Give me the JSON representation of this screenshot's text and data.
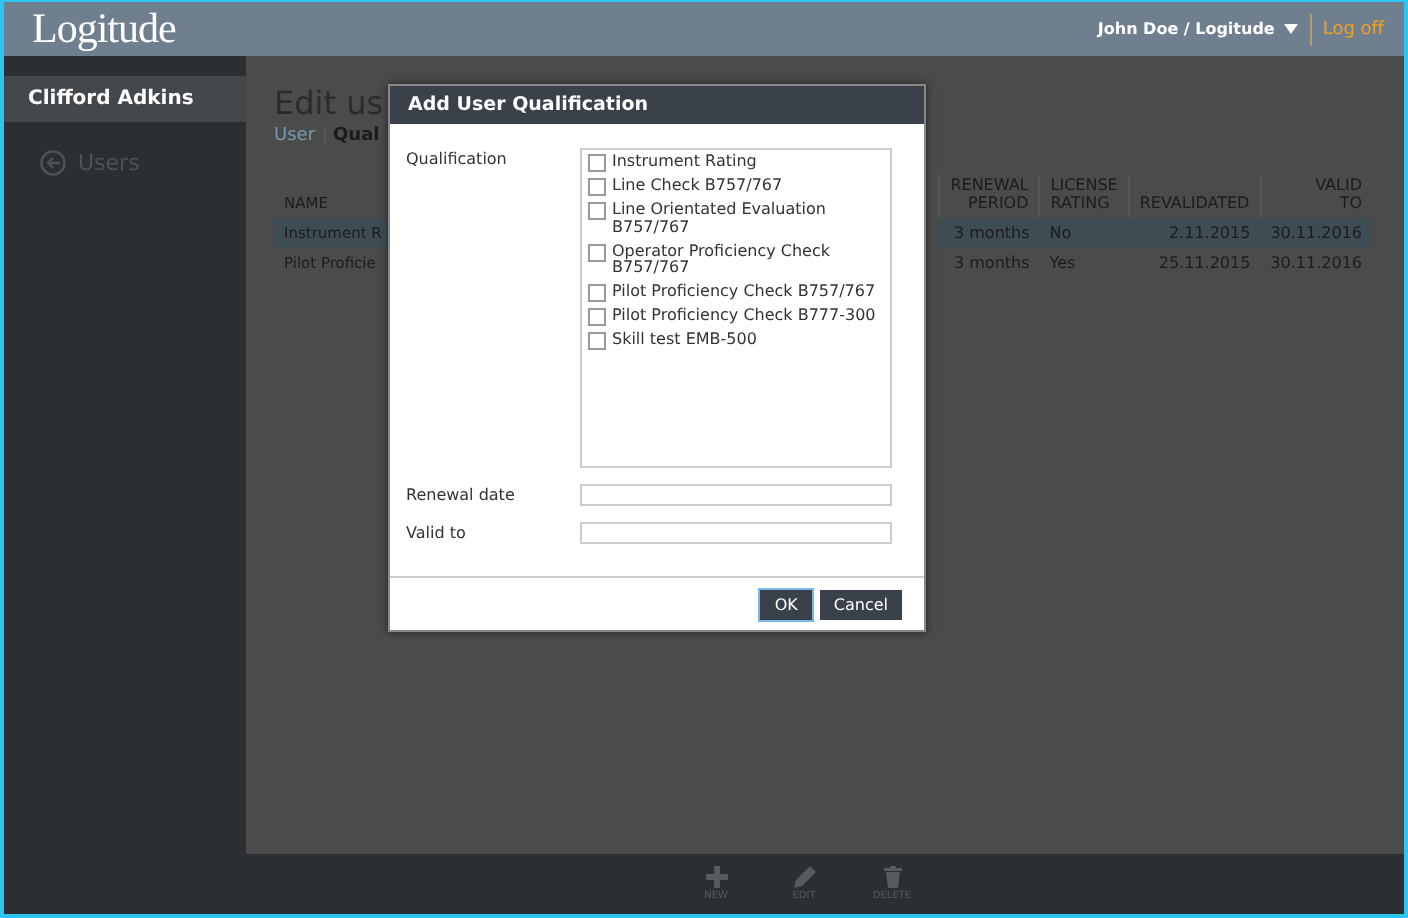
{
  "header": {
    "logo": "Logitude",
    "user": "John Doe / Logitude",
    "logoff": "Log off"
  },
  "sidebar": {
    "user_name": "Clifford Adkins",
    "items": [
      {
        "label": "Users",
        "selected": false
      }
    ]
  },
  "page": {
    "title": "Edit us",
    "breadcrumb": [
      {
        "label": "User",
        "selected": false
      },
      {
        "label": "Qual",
        "selected": true
      }
    ]
  },
  "table": {
    "columns": [
      "NAME",
      "RENEWAL PERIOD",
      "LICENSE RATING",
      "REVALIDATED",
      "VALID TO"
    ],
    "rows": [
      {
        "selected": true,
        "cells": [
          "Instrument R",
          "3 months",
          "No",
          "2.11.2015",
          "30.11.2016"
        ]
      },
      {
        "selected": false,
        "cells": [
          "Pilot Proficie",
          "3 months",
          "Yes",
          "25.11.2015",
          "30.11.2016"
        ]
      }
    ]
  },
  "dialog": {
    "title": "Add User Qualification",
    "qualification_label": "Qualification",
    "options": [
      {
        "label": "Instrument Rating",
        "checked": false
      },
      {
        "label": "Line Check B757/767",
        "checked": false
      },
      {
        "label": "Line Orientated Evaluation B757/767",
        "checked": false
      },
      {
        "label": "Operator Proficiency Check B757/767",
        "checked": false
      },
      {
        "label": "Pilot Proficiency Check B757/767",
        "checked": false
      },
      {
        "label": "Pilot Proficiency Check B777-300",
        "checked": false
      },
      {
        "label": "Skill test EMB-500",
        "checked": false
      }
    ],
    "fields": [
      {
        "label": "Renewal date"
      },
      {
        "label": "Valid to"
      }
    ],
    "buttons": [
      {
        "label": "OK",
        "selected": true
      },
      {
        "label": "Cancel",
        "selected": false
      }
    ]
  },
  "toolbar": [
    {
      "kind": "new",
      "label": "NEW"
    },
    {
      "kind": "edit",
      "label": "EDIT"
    },
    {
      "kind": "delete",
      "label": "DELETE"
    }
  ]
}
